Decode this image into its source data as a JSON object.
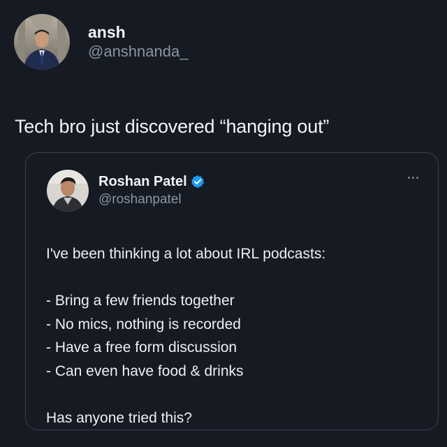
{
  "tweet": {
    "author": {
      "name": "ansh",
      "handle": "@anshnanda_",
      "avatar": "profile-photo"
    },
    "text": "Tech bro just discovered “hanging out”"
  },
  "quoted_tweet": {
    "author": {
      "name": "Roshan Patel",
      "handle": "@roshanpatel",
      "verified": true,
      "avatar": "profile-photo"
    },
    "more_icon": "ellipsis-icon",
    "body": {
      "intro": "I've been thinking a lot about IRL podcasts:",
      "bullets": [
        "- Bring a few friends together",
        "- No mics, nothing is recorded",
        "- Have a free form discussion",
        "- Can even have food & drinks"
      ],
      "closing": "Has anyone tried this?"
    }
  },
  "colors": {
    "background": "#151a23",
    "primary_text": "#f2f4f7",
    "secondary_text": "#8b95a3",
    "card_border": "#3a4250",
    "verified_badge": "#1d9bf0"
  }
}
